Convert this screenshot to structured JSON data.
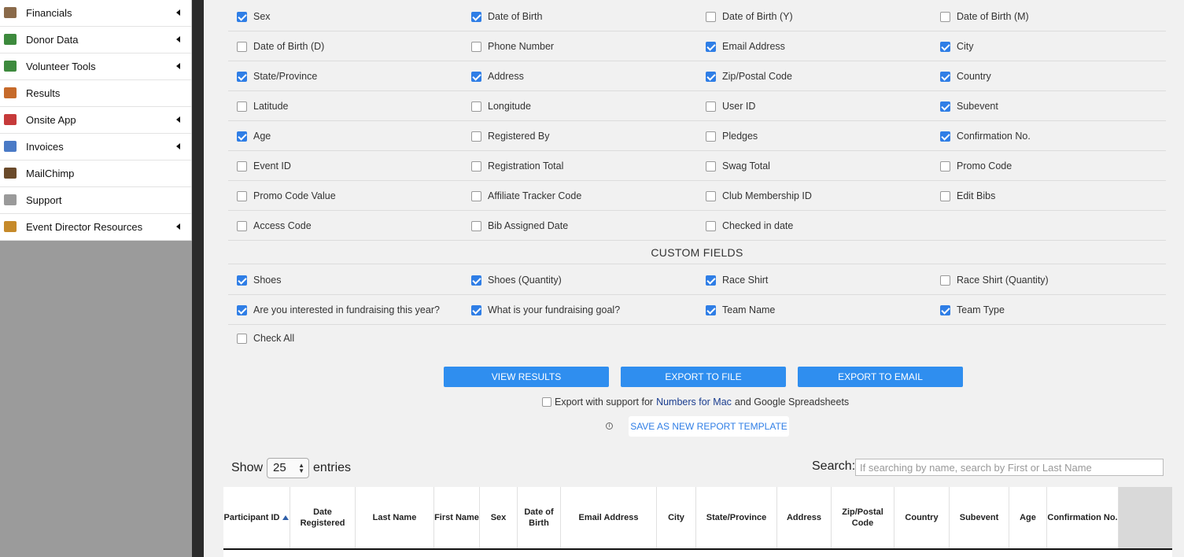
{
  "sidebar": {
    "items": [
      {
        "label": "Financials",
        "icon": "financials-icon",
        "icon_color": "#8a6a4a",
        "has_caret": true
      },
      {
        "label": "Donor Data",
        "icon": "donor-data-icon",
        "icon_color": "#3d8a3d",
        "has_caret": true
      },
      {
        "label": "Volunteer Tools",
        "icon": "volunteer-tools-icon",
        "icon_color": "#3d8a3d",
        "has_caret": true
      },
      {
        "label": "Results",
        "icon": "results-icon",
        "icon_color": "#c66a2a",
        "has_caret": false
      },
      {
        "label": "Onsite App",
        "icon": "megaphone-icon",
        "icon_color": "#c63a3a",
        "has_caret": true
      },
      {
        "label": "Invoices",
        "icon": "invoices-icon",
        "icon_color": "#4a7ac6",
        "has_caret": true
      },
      {
        "label": "MailChimp",
        "icon": "mailchimp-icon",
        "icon_color": "#6a4a2a",
        "has_caret": false
      },
      {
        "label": "Support",
        "icon": "envelope-icon",
        "icon_color": "#9a9a9a",
        "has_caret": false
      },
      {
        "label": "Event Director Resources",
        "icon": "resources-icon",
        "icon_color": "#c68a2a",
        "has_caret": true
      }
    ]
  },
  "fields": {
    "rows": [
      [
        {
          "label": "Sex",
          "checked": true
        },
        {
          "label": "Date of Birth",
          "checked": true
        },
        {
          "label": "Date of Birth (Y)",
          "checked": false
        },
        {
          "label": "Date of Birth (M)",
          "checked": false
        }
      ],
      [
        {
          "label": "Date of Birth (D)",
          "checked": false
        },
        {
          "label": "Phone Number",
          "checked": false
        },
        {
          "label": "Email Address",
          "checked": true
        },
        {
          "label": "City",
          "checked": true
        }
      ],
      [
        {
          "label": "State/Province",
          "checked": true
        },
        {
          "label": "Address",
          "checked": true
        },
        {
          "label": "Zip/Postal Code",
          "checked": true
        },
        {
          "label": "Country",
          "checked": true
        }
      ],
      [
        {
          "label": "Latitude",
          "checked": false
        },
        {
          "label": "Longitude",
          "checked": false
        },
        {
          "label": "User ID",
          "checked": false
        },
        {
          "label": "Subevent",
          "checked": true
        }
      ],
      [
        {
          "label": "Age",
          "checked": true
        },
        {
          "label": "Registered By",
          "checked": false
        },
        {
          "label": "Pledges",
          "checked": false
        },
        {
          "label": "Confirmation No.",
          "checked": true
        }
      ],
      [
        {
          "label": "Event ID",
          "checked": false
        },
        {
          "label": "Registration Total",
          "checked": false
        },
        {
          "label": "Swag Total",
          "checked": false
        },
        {
          "label": "Promo Code",
          "checked": false
        }
      ],
      [
        {
          "label": "Promo Code Value",
          "checked": false
        },
        {
          "label": "Affiliate Tracker Code",
          "checked": false
        },
        {
          "label": "Club Membership ID",
          "checked": false
        },
        {
          "label": "Edit Bibs",
          "checked": false
        }
      ],
      [
        {
          "label": "Access Code",
          "checked": false
        },
        {
          "label": "Bib Assigned Date",
          "checked": false
        },
        {
          "label": "Checked in date",
          "checked": false
        }
      ]
    ],
    "custom_title": "CUSTOM FIELDS",
    "custom_rows": [
      [
        {
          "label": "Shoes",
          "checked": true
        },
        {
          "label": "Shoes (Quantity)",
          "checked": true
        },
        {
          "label": "Race Shirt",
          "checked": true
        },
        {
          "label": "Race Shirt (Quantity)",
          "checked": false
        }
      ],
      [
        {
          "label": "Are you interested in fundraising this year?",
          "checked": true
        },
        {
          "label": "What is your fundraising goal?",
          "checked": true
        },
        {
          "label": "Team Name",
          "checked": true
        },
        {
          "label": "Team Type",
          "checked": true
        }
      ]
    ],
    "check_all": {
      "label": "Check All",
      "checked": false
    }
  },
  "actions": {
    "view_results": "VIEW RESULTS",
    "export_file": "EXPORT TO FILE",
    "export_email": "EXPORT TO EMAIL",
    "export_support": {
      "checked": false,
      "prefix": "Export with support for",
      "link": "Numbers for Mac",
      "suffix": "and Google Spreadsheets"
    },
    "info_icon": "info-icon",
    "save_template": "SAVE AS NEW REPORT TEMPLATE"
  },
  "table": {
    "show_label": "Show",
    "entries_value": "25",
    "entries_label": "entries",
    "search_label": "Search:",
    "search_placeholder": "If searching by name, search by First or Last Name",
    "search_value": "",
    "sorted_column": "Participant ID",
    "sort_direction": "ascending",
    "columns": [
      "Participant ID",
      "Date Registered",
      "Last Name",
      "First Name",
      "Sex",
      "Date of Birth",
      "Email Address",
      "City",
      "State/Province",
      "Address",
      "Zip/Postal Code",
      "Country",
      "Subevent",
      "Age",
      "Confirmation No.",
      ""
    ]
  }
}
